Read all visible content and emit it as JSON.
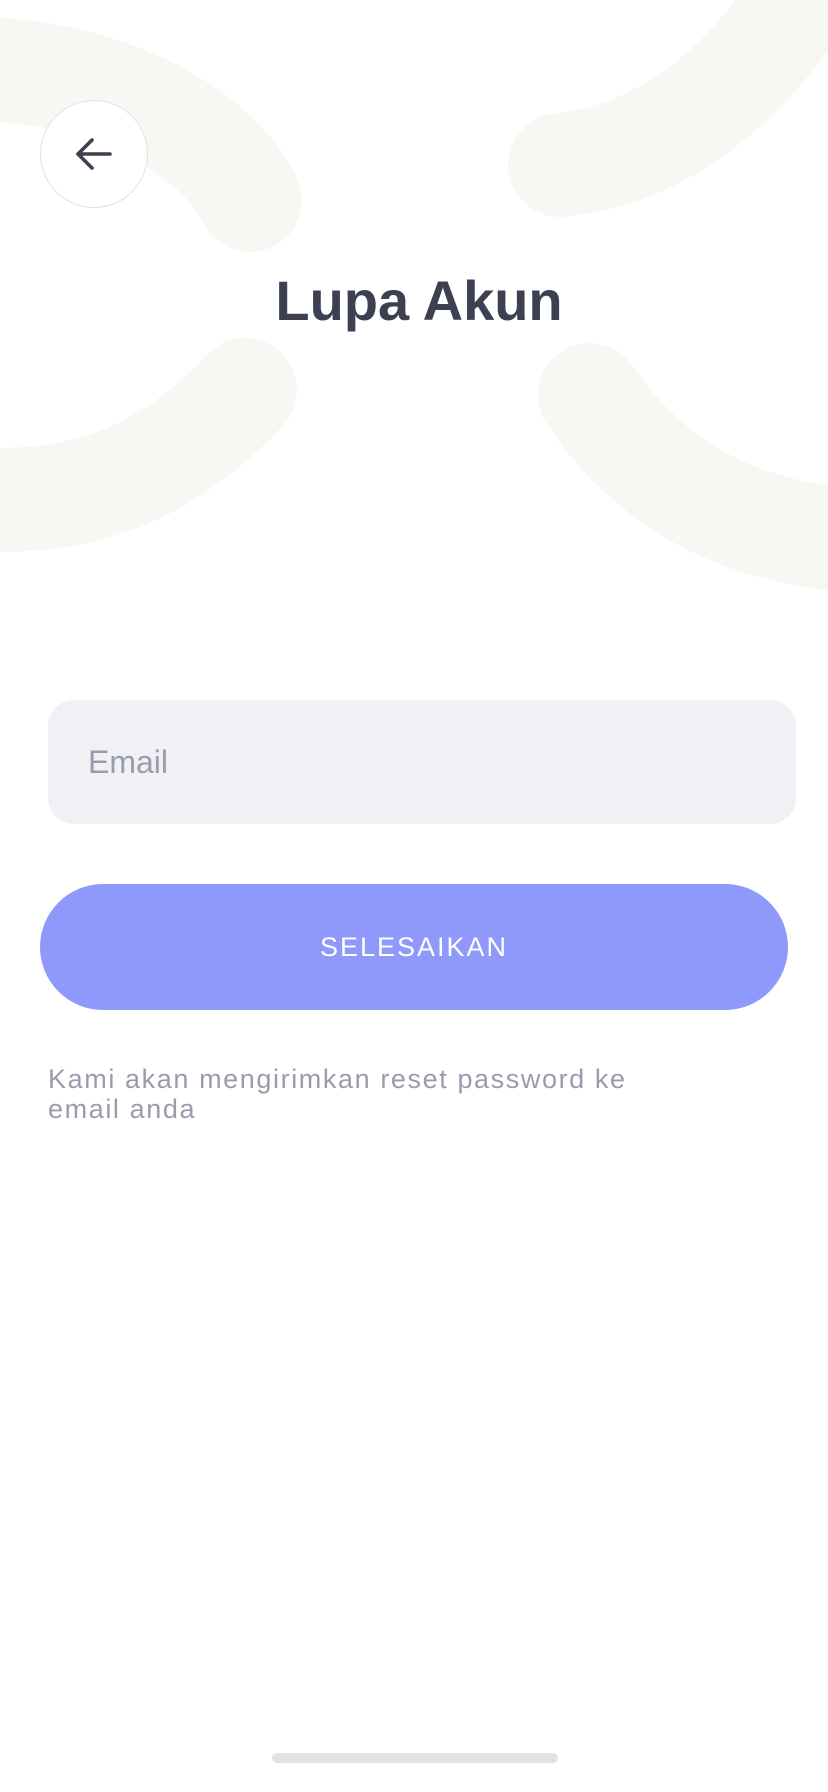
{
  "header": {
    "back_icon": "arrow-left-icon",
    "title": "Lupa Akun"
  },
  "form": {
    "email": {
      "placeholder": "Email",
      "value": ""
    },
    "submit_label": "SELESAIKAN",
    "helper_text": "Kami akan mengirimkan reset password ke email anda"
  },
  "colors": {
    "title": "#3d4050",
    "input_background": "#f0f1f5",
    "button_background": "#8f99fc",
    "button_text": "#ffffff",
    "helper_text": "#9a9cab",
    "background_decor": "#f8f7f4"
  }
}
